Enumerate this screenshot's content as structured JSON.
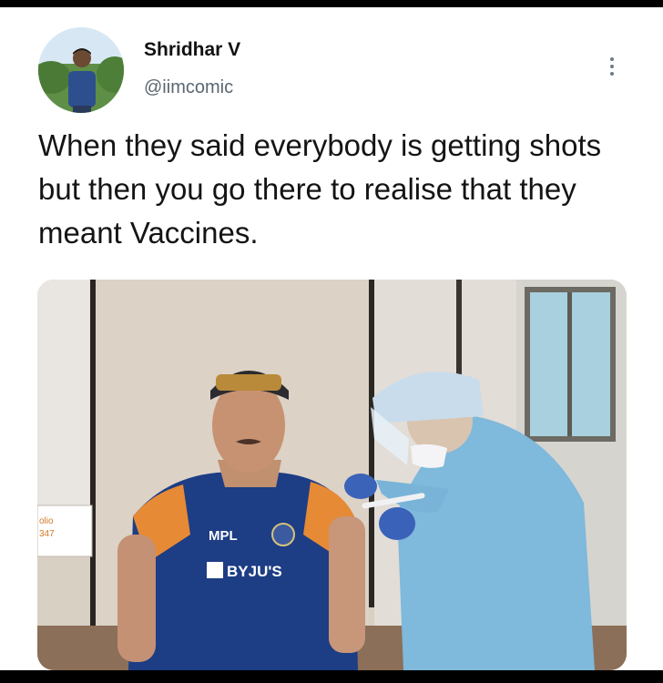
{
  "author": {
    "name": "Shridhar V",
    "handle": "@iimcomic"
  },
  "tweet": {
    "text": "When they said everybody is getting shots but then you go there to realise that they meant Vaccines."
  },
  "media": {
    "jersey_logo": "MPL",
    "jersey_sponsor": "BYJU'S",
    "sign_text": "olio",
    "sign_number": "347"
  },
  "icons": {
    "more": "more-vertical-icon"
  }
}
